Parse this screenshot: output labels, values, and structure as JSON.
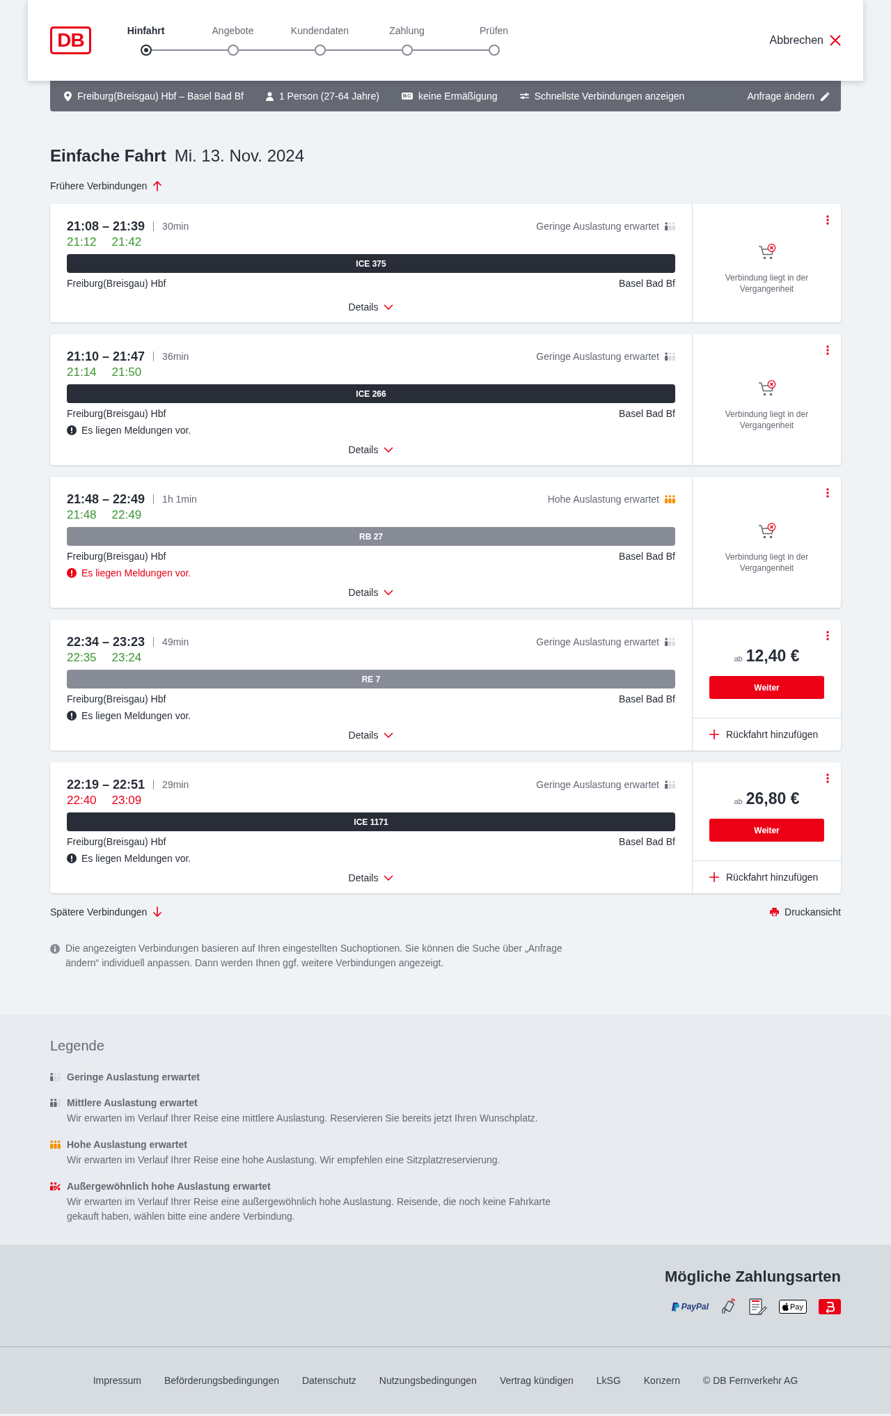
{
  "header": {
    "logo": "DB",
    "steps": [
      {
        "label": "Hinfahrt",
        "selected": true
      },
      {
        "label": "Angebote",
        "selected": false
      },
      {
        "label": "Kundendaten",
        "selected": false
      },
      {
        "label": "Zahlung",
        "selected": false
      },
      {
        "label": "Prüfen",
        "selected": false
      }
    ],
    "cancel": "Abbrechen"
  },
  "summary": {
    "route": "Freiburg(Breisgau) Hbf – Basel Bad Bf",
    "travellers": "1 Person (27-64 Jahre)",
    "card_badge": "BC",
    "discount": "keine Ermäßigung",
    "search_option": "Schnellste Verbindungen anzeigen",
    "edit": "Anfrage ändern"
  },
  "results": {
    "trip_type": "Einfache Fahrt",
    "date": "Mi. 13. Nov. 2024",
    "earlier": "Frühere Verbindungen",
    "connections": [
      {
        "times": "21:08 – 21:39",
        "duration": "30min",
        "realtime_departure": "21:12",
        "realtime_arrival": "21:42",
        "punctual": true,
        "occupancy": {
          "kind": "low",
          "text": "Geringe Auslastung erwartet"
        },
        "train": {
          "kind": "express",
          "label": "ICE 375"
        },
        "from": "Freiburg(Breisgau) Hbf",
        "to": "Basel Bad Bf",
        "details": "Details",
        "offer": {
          "kind": "unavailable",
          "text": "Verbindung liegt in der Vergangenheit"
        }
      },
      {
        "times": "21:10 – 21:47",
        "duration": "36min",
        "realtime_departure": "21:14",
        "realtime_arrival": "21:50",
        "punctual": true,
        "occupancy": {
          "kind": "low",
          "text": "Geringe Auslastung erwartet"
        },
        "train": {
          "kind": "express",
          "label": "ICE 266"
        },
        "from": "Freiburg(Breisgau) Hbf",
        "to": "Basel Bad Bf",
        "message": {
          "kind": "notice",
          "text": "Es liegen Meldungen vor."
        },
        "details": "Details",
        "offer": {
          "kind": "unavailable",
          "text": "Verbindung liegt in der Vergangenheit"
        }
      },
      {
        "times": "21:48 – 22:49",
        "duration": "1h 1min",
        "realtime_departure": "21:48",
        "realtime_arrival": "22:49",
        "punctual": true,
        "occupancy": {
          "kind": "high",
          "text": "Hohe Auslastung erwartet"
        },
        "train": {
          "kind": "regional",
          "label": "RB 27"
        },
        "from": "Freiburg(Breisgau) Hbf",
        "to": "Basel Bad Bf",
        "message": {
          "kind": "alert",
          "text": "Es liegen Meldungen vor."
        },
        "details": "Details",
        "offer": {
          "kind": "unavailable",
          "text": "Verbindung liegt in der Vergangenheit"
        }
      },
      {
        "times": "22:34 – 23:23",
        "duration": "49min",
        "realtime_departure": "22:35",
        "realtime_arrival": "23:24",
        "punctual": true,
        "occupancy": {
          "kind": "low",
          "text": "Geringe Auslastung erwartet"
        },
        "train": {
          "kind": "regional",
          "label": "RE 7"
        },
        "from": "Freiburg(Breisgau) Hbf",
        "to": "Basel Bad Bf",
        "message": {
          "kind": "notice",
          "text": "Es liegen Meldungen vor."
        },
        "details": "Details",
        "offer": {
          "kind": "price",
          "prefix": "ab",
          "price": "12,40 €",
          "button": "Weiter",
          "return_trip": "Rückfahrt hinzufügen"
        }
      },
      {
        "times": "22:19 – 22:51",
        "duration": "29min",
        "realtime_departure": "22:40",
        "realtime_arrival": "23:09",
        "punctual": false,
        "occupancy": {
          "kind": "low",
          "text": "Geringe Auslastung erwartet"
        },
        "train": {
          "kind": "express",
          "label": "ICE 1171"
        },
        "from": "Freiburg(Breisgau) Hbf",
        "to": "Basel Bad Bf",
        "message": {
          "kind": "notice",
          "text": "Es liegen Meldungen vor."
        },
        "details": "Details",
        "offer": {
          "kind": "price",
          "prefix": "ab",
          "price": "26,80 €",
          "button": "Weiter",
          "return_trip": "Rückfahrt hinzufügen"
        }
      }
    ],
    "later": "Spätere Verbindungen",
    "print": "Druckansicht",
    "note": "Die angezeigten Verbindungen basieren auf Ihren eingestellten Suchoptionen. Sie können die Suche über „Anfrage ändern“ individuell anpassen. Dann werden Ihnen ggf. weitere Verbindungen angezeigt."
  },
  "legend": {
    "title": "Legende",
    "items": [
      {
        "kind": "low",
        "title": "Geringe Auslastung erwartet"
      },
      {
        "kind": "medium",
        "title": "Mittlere Auslastung erwartet",
        "text": "Wir erwarten im Verlauf Ihrer Reise eine mittlere Auslastung. Reservieren Sie bereits jetzt Ihren Wunschplatz."
      },
      {
        "kind": "high",
        "title": "Hohe Auslastung erwartet",
        "text": "Wir erwarten im Verlauf Ihrer Reise eine hohe Auslastung. Wir empfehlen eine Sitzplatzreservierung."
      },
      {
        "kind": "extreme",
        "title": "Außergewöhnlich hohe Auslastung erwartet",
        "text": "Wir erwarten im Verlauf Ihrer Reise eine außergewöhnlich hohe Auslastung. Reisende, die noch keine Fahrkarte gekauft haben, wählen bitte eine andere Verbindung."
      }
    ]
  },
  "payment": {
    "title": "Mögliche Zahlungsarten",
    "methods": [
      {
        "kind": "paypal",
        "label": "PayPal"
      },
      {
        "kind": "contactless"
      },
      {
        "kind": "sepa"
      },
      {
        "kind": "applepay",
        "label": "Pay"
      },
      {
        "kind": "app"
      }
    ]
  },
  "footer": {
    "links": [
      "Impressum",
      "Beförderungsbedingungen",
      "Datenschutz",
      "Nutzungsbedingungen",
      "Vertrag kündigen",
      "LkSG",
      "Konzern"
    ],
    "copyright": "© DB Fernverkehr AG"
  }
}
